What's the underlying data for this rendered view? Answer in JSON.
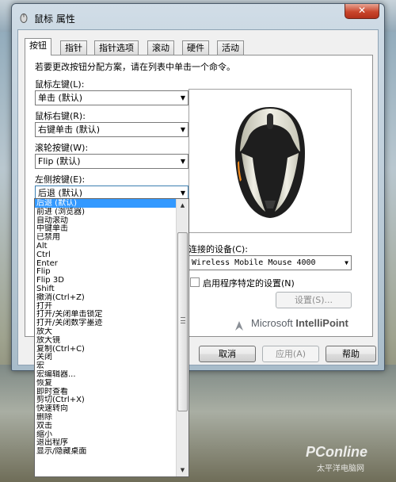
{
  "window": {
    "title": "鼠标 属性",
    "close_label": "✕"
  },
  "tabs": [
    "按钮",
    "指针",
    "指针选项",
    "滚动",
    "硬件",
    "活动"
  ],
  "instructions": "若要更改按钮分配方案，请在列表中单击一个命令。",
  "buttons": {
    "left": {
      "label": "鼠标左键(L):",
      "value": "单击 (默认)"
    },
    "right": {
      "label": "鼠标右键(R):",
      "value": "右键单击 (默认)"
    },
    "wheel": {
      "label": "滚轮按键(W):",
      "value": "Flip (默认)"
    },
    "side": {
      "label": "左侧按键(E):",
      "value": "后退 (默认)"
    }
  },
  "device": {
    "label": "连接的设备(C):",
    "value": "Wireless Mobile Mouse 4000"
  },
  "app_specific": {
    "label": "启用程序特定的设置(N)",
    "checked": false
  },
  "settings_button": "设置(S)...",
  "brand": {
    "microsoft": "Microsoft",
    "product": "IntelliPoint"
  },
  "footer": {
    "cancel": "取消",
    "apply": "应用(A)",
    "help": "帮助"
  },
  "dropdown_items": [
    "后退 (默认)",
    "前进 (浏览器)",
    "自动滚动",
    "中键单击",
    "已禁用",
    "Alt",
    "Ctrl",
    "Enter",
    "Flip",
    "Flip 3D",
    "Shift",
    "撤消(Ctrl+Z)",
    "打开",
    "打开/关闭单击锁定",
    "打开/关闭数字墨迹",
    "放大",
    "放大镜",
    "复制(Ctrl+C)",
    "关闭",
    "宏",
    "宏编辑器...",
    "恢复",
    "即时查看",
    "剪切(Ctrl+X)",
    "快速转向",
    "删除",
    "双击",
    "缩小",
    "退出程序",
    "显示/隐藏桌面"
  ],
  "watermark": {
    "brand": "PConline",
    "sub": "太平洋电脑网"
  }
}
